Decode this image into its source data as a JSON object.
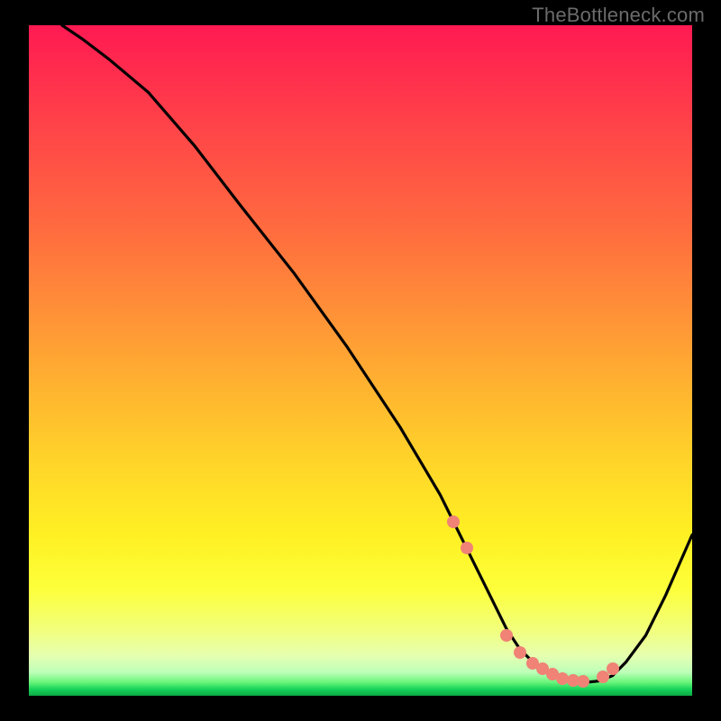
{
  "watermark": "TheBottleneck.com",
  "chart_data": {
    "type": "line",
    "title": "",
    "xlabel": "",
    "ylabel": "",
    "xlim": [
      0,
      100
    ],
    "ylim": [
      0,
      100
    ],
    "grid": false,
    "legend": false,
    "series": [
      {
        "name": "curve",
        "color": "#000000",
        "x": [
          5,
          8,
          12,
          18,
          25,
          32,
          40,
          48,
          56,
          62,
          65,
          68,
          70,
          72,
          74,
          76,
          78,
          80,
          82,
          84,
          86,
          88,
          90,
          93,
          96,
          100
        ],
        "y": [
          100,
          98,
          95,
          90,
          82,
          73,
          63,
          52,
          40,
          30,
          24,
          18,
          14,
          10,
          7,
          5,
          3.5,
          2.5,
          2,
          2,
          2.2,
          3,
          5,
          9,
          15,
          24
        ]
      }
    ],
    "markers": {
      "name": "highlight-points",
      "color": "#f08276",
      "x": [
        64,
        66,
        72,
        74,
        76,
        77.5,
        79,
        80.5,
        82,
        83.5,
        86.5,
        88
      ],
      "y": [
        26,
        22,
        9,
        6.5,
        4.8,
        4,
        3.2,
        2.6,
        2.3,
        2.2,
        2.8,
        4
      ]
    },
    "background": {
      "type": "vertical-gradient",
      "stops": [
        {
          "pos": 0,
          "color": "#ff1a52"
        },
        {
          "pos": 0.3,
          "color": "#ff6a3f"
        },
        {
          "pos": 0.66,
          "color": "#ffd729"
        },
        {
          "pos": 0.9,
          "color": "#f2ff7a"
        },
        {
          "pos": 1.0,
          "color": "#0aa845"
        }
      ]
    }
  }
}
